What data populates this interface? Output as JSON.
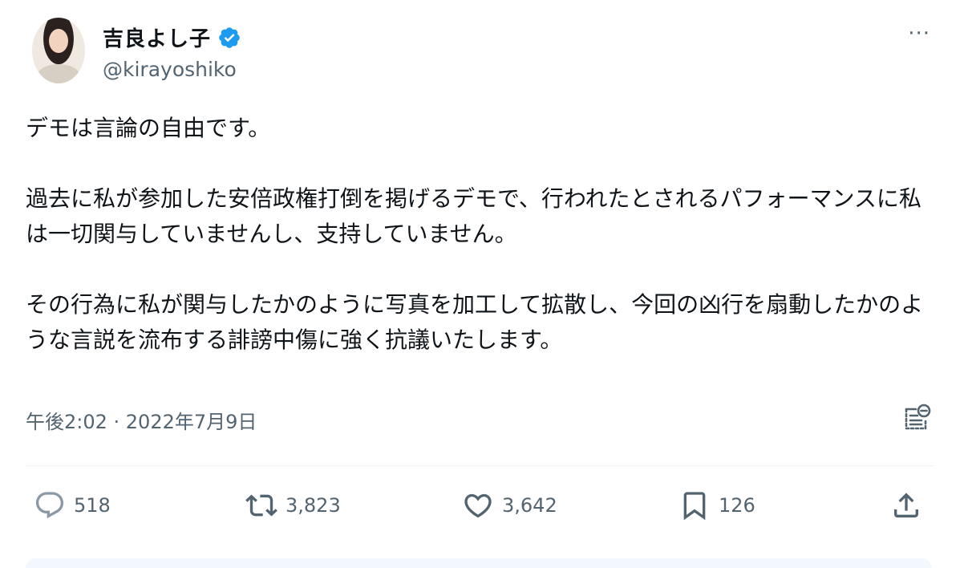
{
  "author": {
    "display_name": "吉良よし子",
    "handle": "@kirayoshiko",
    "verified": true,
    "avatar_alt": "profile photo"
  },
  "menu": {
    "more_label": "···"
  },
  "body": {
    "paragraphs": [
      "デモは言論の自由です。",
      "過去に私が参加した安倍政権打倒を掲げるデモで、行われたとされるパフォーマンスに私は一切関与していませんし、支持していません。",
      "その行為に私が関与したかのように写真を加工して拡散し、今回の凶行を扇動したかのような言説を流布する誹謗中傷に強く抗議いたします。"
    ]
  },
  "meta": {
    "timestamp": "午後2:02 · 2022年7月9日"
  },
  "stats": {
    "replies": "518",
    "reposts": "3,823",
    "likes": "3,642",
    "bookmarks": "126"
  },
  "colors": {
    "text": "#0f1419",
    "secondary": "#536471",
    "verified": "#1d9bf0",
    "divider": "#eff3f4"
  },
  "icons": {
    "verified": "verified-badge-icon",
    "more": "more-icon",
    "notes": "community-notes-icon",
    "reply": "reply-icon",
    "repost": "repost-icon",
    "like": "heart-icon",
    "bookmark": "bookmark-icon",
    "share": "share-icon"
  }
}
